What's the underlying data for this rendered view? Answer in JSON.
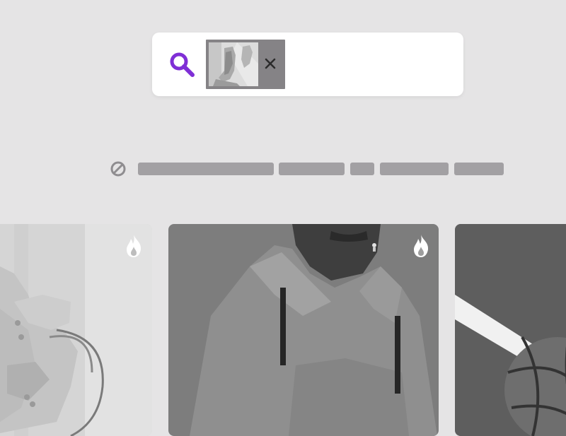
{
  "search": {
    "icon": "search-icon",
    "icon_color": "#7f2fd6",
    "chip": {
      "thumbnail": "sneaker-photo-thumbnail",
      "remove_icon": "close-icon"
    }
  },
  "filters": {
    "none_icon": "block-icon",
    "placeholder_count": 5
  },
  "cards": [
    {
      "image": "sneaker-photo",
      "badge_icon": "flame-icon"
    },
    {
      "image": "hoodie-model-photo",
      "badge_icon": "flame-icon"
    },
    {
      "image": "basketball-court-photo",
      "badge_icon": ""
    }
  ],
  "colors": {
    "background": "#e5e4e5",
    "accent": "#7f2fd6",
    "placeholder": "#a2a0a3",
    "chip": "#858386"
  }
}
